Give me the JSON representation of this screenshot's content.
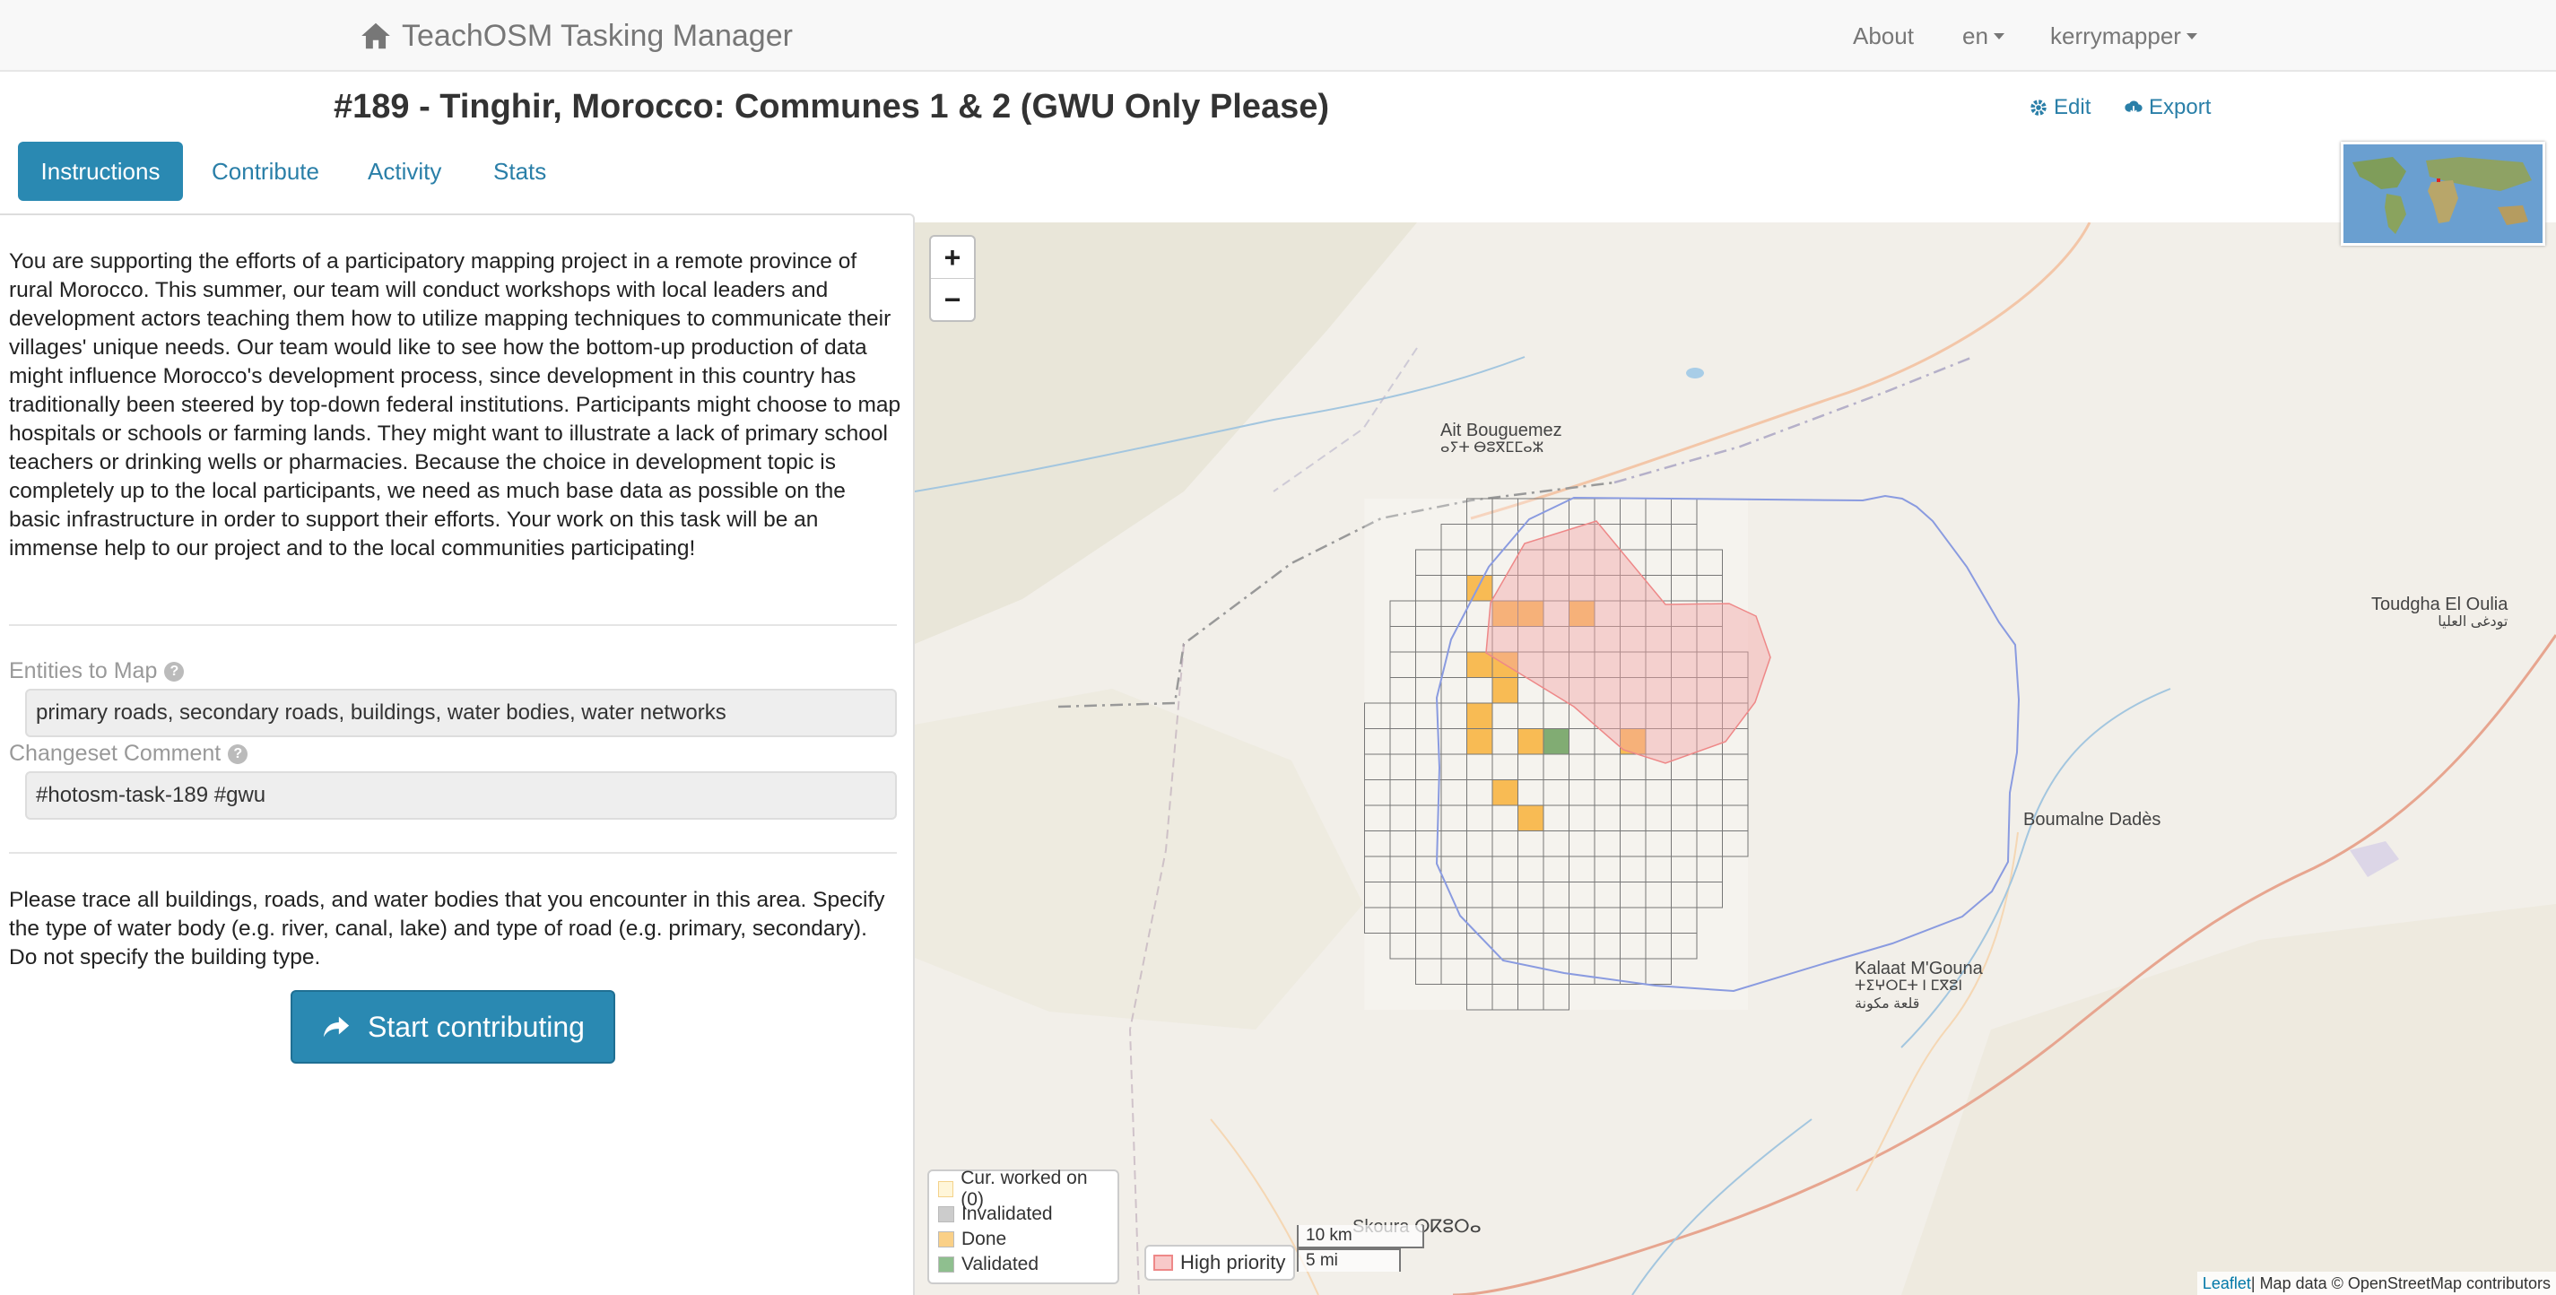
{
  "navbar": {
    "brand": "TeachOSM Tasking Manager",
    "about": "About",
    "language": "en",
    "user": "kerrymapper"
  },
  "project": {
    "title": "#189 - Tinghir, Morocco: Communes 1 & 2 (GWU Only Please)",
    "edit_label": "Edit",
    "export_label": "Export"
  },
  "tabs": [
    {
      "label": "Instructions",
      "active": true
    },
    {
      "label": "Contribute",
      "active": false
    },
    {
      "label": "Activity",
      "active": false
    },
    {
      "label": "Stats",
      "active": false
    }
  ],
  "instructions": {
    "description": "You are supporting the efforts of a participatory mapping project in a remote province of rural Morocco. This summer, our team will conduct workshops with local leaders and development actors teaching them how to utilize mapping techniques to communicate their villages' unique needs. Our team would like to see how the bottom-up production of data might influence Morocco's development process, since development in this country has traditionally been steered by top-down federal institutions. Participants might choose to map hospitals or schools or farming lands. They might want to illustrate a lack of primary school teachers or drinking wells or pharmacies. Because the choice in development topic is completely up to the local participants, we need as much base data as possible on the basic infrastructure in order to support their efforts. Your work on this task will be an immense help to our project and to the local communities participating!",
    "entities_label": "Entities to Map",
    "entities_value": "primary roads, secondary roads, buildings, water bodies, water networks",
    "changeset_label": "Changeset Comment",
    "changeset_value": "#hotosm-task-189 #gwu",
    "note": "Please trace all buildings, roads, and water bodies that you encounter in this area. Specify the type of water body (e.g. river, canal, lake) and type of road (e.g. primary, secondary). Do not specify the building type.",
    "start_button": "Start contributing"
  },
  "map": {
    "zoom_in": "+",
    "zoom_out": "−",
    "places": {
      "ait_bouguemez": "Ait Bouguemez",
      "ait_bouguemez_tif": "ⴰⵢⵜ ⴱⵓⴳⵎⵎⴰⵣ",
      "toudgha": "Toudgha El Oulia",
      "toudgha_ar": "تودغى العليا",
      "boumalne": "Boumalne Dadès",
      "kalaat": "Kalaat M'Gouna",
      "kalaat_tif": "ⵜⵉⵖⵔⵎⵜ ⵏ ⵎⴳⵓⵏ",
      "kalaat_ar": "قلعة مكونة",
      "skoura": "Skoura ⵙⴽⵓⵔⴰ"
    },
    "legend": [
      {
        "label": "Cur. worked on (0)",
        "color": "#fff6d9"
      },
      {
        "label": "Invalidated",
        "color": "#cccccc"
      },
      {
        "label": "Done",
        "color": "#fad087"
      },
      {
        "label": "Validated",
        "color": "#8fbf8f"
      }
    ],
    "high_priority_label": "High priority",
    "scale_km": "10 km",
    "scale_mi": "5 mi",
    "attribution_link": "Leaflet",
    "attribution_text": " | Map data © OpenStreetMap contributors"
  },
  "colors": {
    "accent": "#2a89b2",
    "done": "#f8b74b",
    "validated": "#7aa86b",
    "high_priority": "#f4a7a7",
    "aoi_outline": "#8a9be0"
  }
}
